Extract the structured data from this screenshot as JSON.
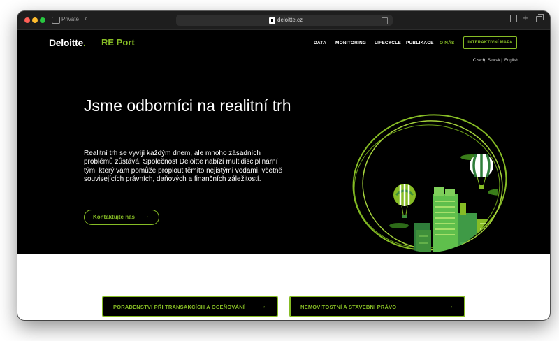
{
  "browser": {
    "private_label": "Private",
    "url": "deloitte.cz"
  },
  "header": {
    "logo": "Deloitte",
    "logo_dot": ".",
    "product": "RE Port",
    "nav": [
      "DATA",
      "MONITORING",
      "LIFECYCLE",
      "PUBLIKACE",
      "O NÁS"
    ],
    "active_nav": "O NÁS",
    "cta": "INTERAKTIVNÍ MAPA"
  },
  "languages": {
    "czech": "Czech",
    "slovak": "Slovak",
    "english": "English",
    "separator": "|"
  },
  "hero": {
    "title": "Jsme odborníci na realitní trh",
    "text": "Realitní trh se vyvíjí každým dnem, ale mnoho zásadních problémů zůstává. Společnost Deloitte nabízí multidisciplinární tým, který vám pomůže proplout těmito nejistými vodami, včetně souvisejících právních, daňových a finančních záležitostí.",
    "button": "Kontaktujte nás",
    "arrow": "→"
  },
  "cards": [
    {
      "label": "PORADENSTVÍ PŘI TRANSAKCÍCH A OCEŇOVÁNÍ",
      "arrow": "→"
    },
    {
      "label": "NEMOVITOSTNÍ A STAVEBNÍ PRÁVO",
      "arrow": "→"
    }
  ],
  "colors": {
    "accent": "#86bc25",
    "background": "#000000",
    "section": "#ffffff"
  }
}
